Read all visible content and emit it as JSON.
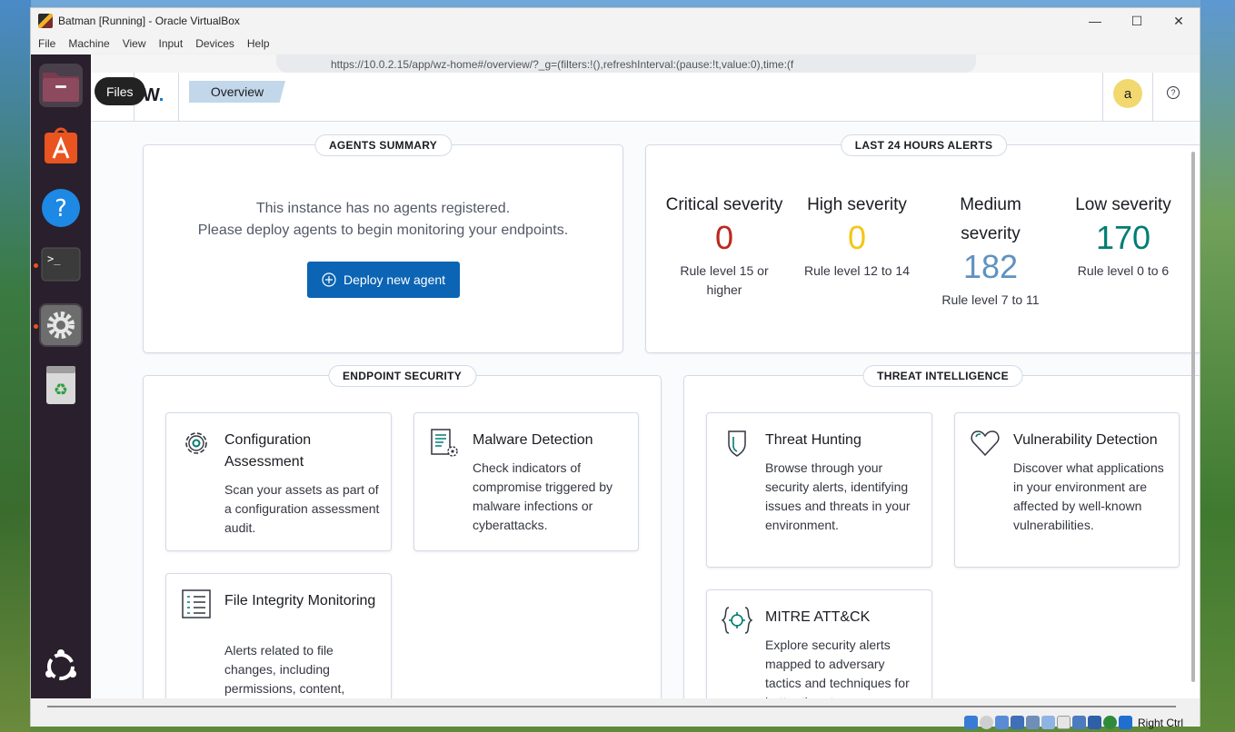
{
  "window": {
    "title": "Batman [Running] - Oracle VirtualBox",
    "controls": {
      "minimize": "—",
      "maximize": "☐",
      "close": "✕"
    },
    "menu": [
      "File",
      "Machine",
      "View",
      "Input",
      "Devices",
      "Help"
    ]
  },
  "dock": {
    "tooltip": "Files",
    "items": [
      "files-icon",
      "app-center-icon",
      "help-icon",
      "terminal-icon",
      "settings-icon",
      "trash-icon",
      "ubuntu-logo-icon"
    ]
  },
  "browser": {
    "url": "https://10.0.2.15/app/wz-home#/overview/?_g=(filters:!(),refreshInterval:(pause:!t,value:0),time:(f"
  },
  "app": {
    "logo_text": "W",
    "breadcrumb": "Overview",
    "avatar_letter": "a",
    "help_glyph": "?"
  },
  "agents_summary": {
    "label": "AGENTS SUMMARY",
    "line1": "This instance has no agents registered.",
    "line2": "Please deploy agents to begin monitoring your endpoints.",
    "deploy_button": "Deploy new agent"
  },
  "alerts": {
    "label": "LAST 24 HOURS ALERTS",
    "items": [
      {
        "name": "Critical severity",
        "value": "0",
        "rule": "Rule level 15 or higher",
        "color": "#bd271e"
      },
      {
        "name": "High severity",
        "value": "0",
        "rule": "Rule level 12 to 14",
        "color": "#f5c518"
      },
      {
        "name": "Medium severity",
        "value": "182",
        "rule": "Rule level 7 to 11",
        "color": "#6092c0"
      },
      {
        "name": "Low severity",
        "value": "170",
        "rule": "Rule level 0 to 6",
        "color": "#017d73"
      }
    ]
  },
  "endpoint_security": {
    "label": "ENDPOINT SECURITY",
    "cards": [
      {
        "title": "Configuration Assessment",
        "desc": "Scan your assets as part of a configuration assessment audit.",
        "icon": "gear-icon"
      },
      {
        "title": "Malware Detection",
        "desc": "Check indicators of compromise triggered by malware infections or cyberattacks.",
        "icon": "document-gear-icon"
      },
      {
        "title": "File Integrity Monitoring",
        "desc": "Alerts related to file changes, including permissions, content,",
        "icon": "list-icon"
      }
    ]
  },
  "threat_intelligence": {
    "label": "THREAT INTELLIGENCE",
    "cards": [
      {
        "title": "Threat Hunting",
        "desc": "Browse through your security alerts, identifying issues and threats in your environment.",
        "icon": "shield-icon"
      },
      {
        "title": "Vulnerability Detection",
        "desc": "Discover what applications in your environment are affected by well-known vulnerabilities.",
        "icon": "heart-icon"
      },
      {
        "title": "MITRE ATT&CK",
        "desc": "Explore security alerts mapped to adversary tactics and techniques for better threat",
        "icon": "target-icon"
      }
    ]
  },
  "statusbar": {
    "host_key": "Right Ctrl"
  }
}
